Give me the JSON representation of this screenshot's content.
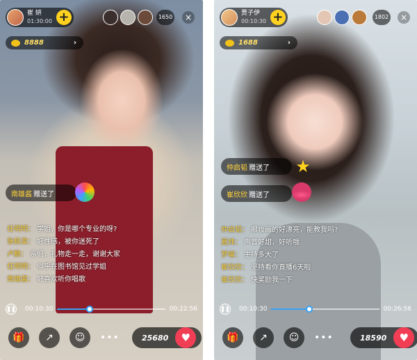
{
  "screens": [
    {
      "streamer": {
        "name": "崔 妍",
        "time": "01:30:00"
      },
      "viewer_count": "1650",
      "coins": "8888",
      "gifts": [
        {
          "sender": "南雄酱",
          "action": "赠送了"
        }
      ],
      "chat": [
        {
          "user": "任明明：",
          "msg": "学姐，你是哪个专业的呀?"
        },
        {
          "user": "张栋梁：",
          "msg": "好性感，被你迷死了"
        },
        {
          "user": "卢鹏：",
          "msg": "亲们，礼物走一走，谢谢大家"
        },
        {
          "user": "任明明：",
          "msg": "似乎在图书馆见过学姐"
        },
        {
          "user": "南雄酱：",
          "msg": "好喜欢听你唱歌"
        }
      ],
      "playback": {
        "current": "00:10:30",
        "total": "00:22:56",
        "progress": 0.3
      },
      "likes": "25680"
    },
    {
      "streamer": {
        "name": "贾子伊",
        "time": "00:10:30"
      },
      "viewer_count": "1802",
      "coins": "1688",
      "gifts": [
        {
          "sender": "仲启韬",
          "action": "赠送了"
        },
        {
          "sender": "崔欣欣",
          "action": "赠送了"
        }
      ],
      "chat": [
        {
          "user": "仲启韬：",
          "msg": "眼妆画的好漂亮，能教我吗?"
        },
        {
          "user": "夏炜：",
          "msg": "声音好甜，好听哦"
        },
        {
          "user": "罗曜：",
          "msg": "主持多大了"
        },
        {
          "user": "崔欣欣：",
          "msg": "坚持看你直播6天啦"
        },
        {
          "user": "崔欣欣：",
          "msg": "快奖励我一下"
        }
      ],
      "playback": {
        "current": "00:10:30",
        "total": "00:26:56",
        "progress": 0.35
      },
      "likes": "18590"
    }
  ],
  "icons": {
    "follow": "+",
    "close": "×",
    "arrow": "›",
    "pause": "pause-icon",
    "gift": "gift-icon",
    "share": "share-icon",
    "face": "emoji-icon",
    "more": "•••",
    "heart": "heart-icon"
  },
  "colors": {
    "accent": "#ffd21f",
    "like": "#f13e55",
    "progress": "#36a3f7",
    "username": "#ffd23a"
  }
}
